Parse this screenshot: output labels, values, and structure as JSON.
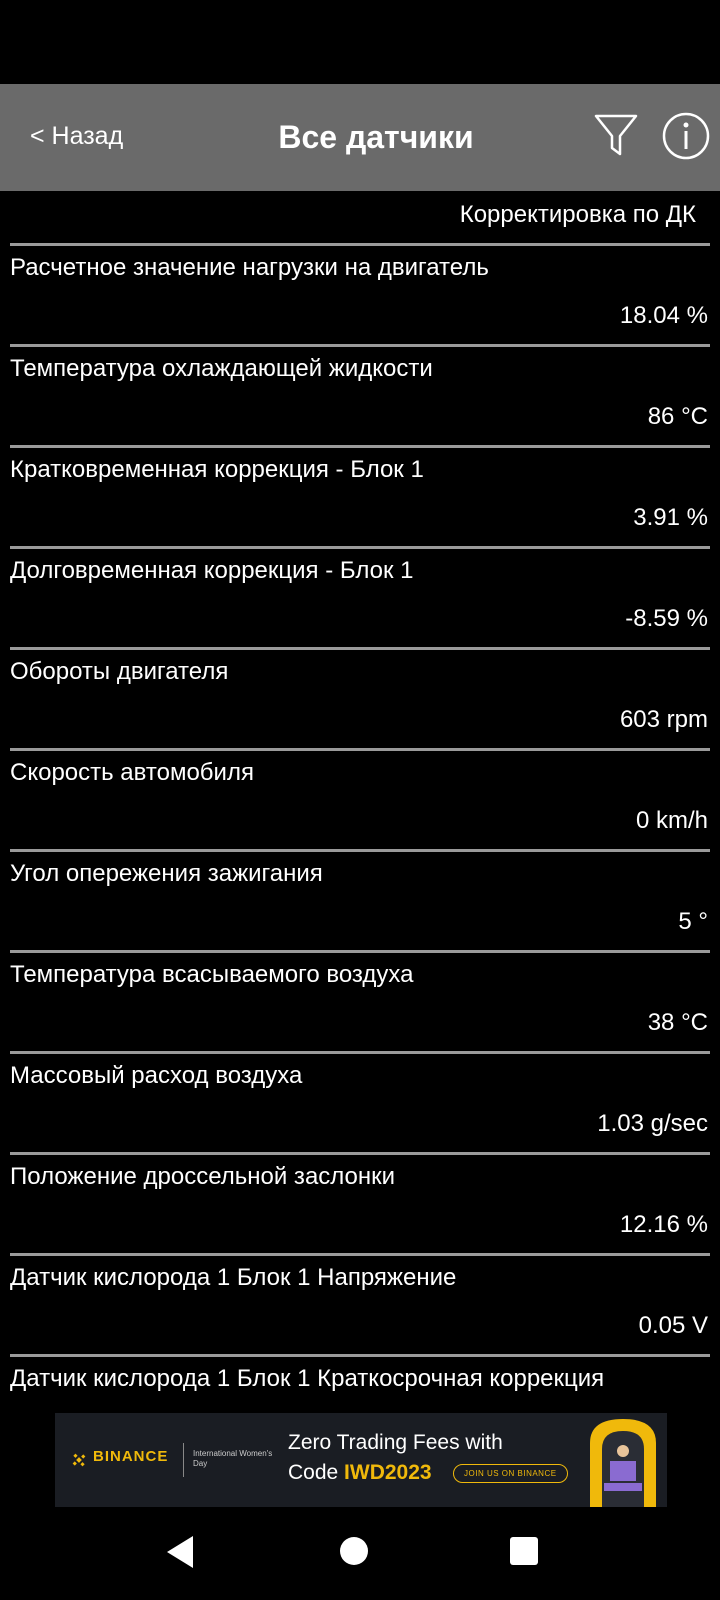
{
  "header": {
    "back_label": "< Назад",
    "title": "Все датчики"
  },
  "section_label": "Корректировка по ДК",
  "sensors": [
    {
      "name": "Расчетное значение нагрузки на двигатель",
      "value": "18.04 %"
    },
    {
      "name": "Температура охлаждающей жидкости",
      "value": "86 °C"
    },
    {
      "name": "Кратковременная коррекция - Блок 1",
      "value": "3.91 %"
    },
    {
      "name": "Долговременная коррекция - Блок 1",
      "value": "-8.59 %"
    },
    {
      "name": "Обороты двигателя",
      "value": "603 rpm"
    },
    {
      "name": "Скорость автомобиля",
      "value": "0 km/h"
    },
    {
      "name": "Угол опережения зажигания",
      "value": "5 °"
    },
    {
      "name": "Температура всасываемого воздуха",
      "value": "38 °C"
    },
    {
      "name": "Массовый расход воздуха",
      "value": "1.03 g/sec"
    },
    {
      "name": "Положение дроссельной заслонки",
      "value": "12.16 %"
    },
    {
      "name": "Датчик кислорода 1 Блок 1 Напряжение",
      "value": "0.05 V"
    },
    {
      "name": "Датчик кислорода 1 Блок 1 Краткосрочная коррекция",
      "value": ""
    }
  ],
  "ad": {
    "brand": "BINANCE",
    "event": "International Women's Day",
    "headline_line1": "Zero Trading Fees with",
    "headline_code_prefix": "Code ",
    "headline_code": "IWD2023",
    "cta": "JOIN US ON BINANCE"
  },
  "colors": {
    "appbar": "#6a6a6a",
    "divider": "#9a9a9a",
    "binance_yellow": "#f0b90b"
  },
  "icons": [
    "filter-icon",
    "info-icon",
    "nav-back-icon",
    "nav-home-icon",
    "nav-recent-icon"
  ]
}
